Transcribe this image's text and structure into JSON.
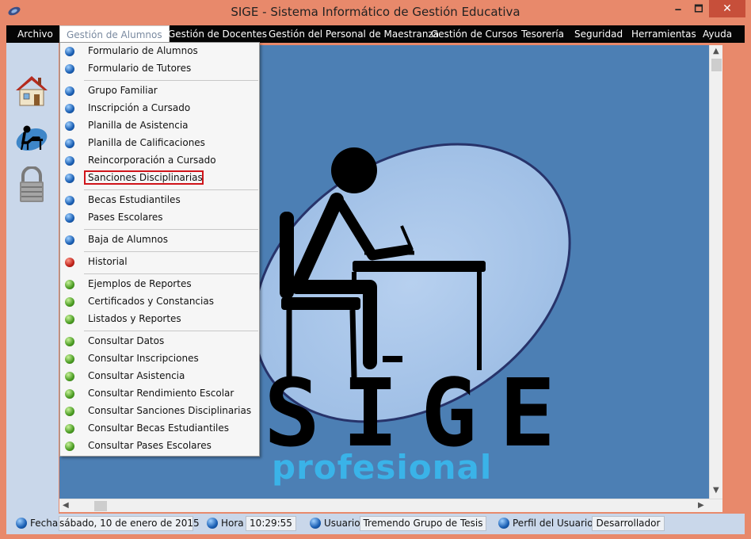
{
  "window": {
    "title": "SIGE - Sistema Informático de Gestión Educativa",
    "minimize": "🗕",
    "maximize": "🗖",
    "close": "✕"
  },
  "menubar": {
    "items": [
      "Archivo",
      "Gestión de Alumnos",
      "Gestión de Docentes",
      "Gestión del Personal de Maestranza",
      "Gestión de Cursos",
      "Tesorería",
      "Seguridad",
      "Herramientas",
      "Ayuda"
    ],
    "active": "Gestión de Alumnos"
  },
  "toolbar": {
    "icons": [
      "home-icon",
      "student-desk-icon",
      "padlock-icon"
    ]
  },
  "dropdown": {
    "items": [
      {
        "label": "Formulario de Alumnos",
        "color": "blue"
      },
      {
        "label": "Formulario de Tutores",
        "color": "blue"
      },
      {
        "label": "Grupo Familiar",
        "color": "blue"
      },
      {
        "label": "Inscripción a Cursado",
        "color": "blue"
      },
      {
        "label": "Planilla de Asistencia",
        "color": "blue"
      },
      {
        "label": "Planilla de Calificaciones",
        "color": "blue"
      },
      {
        "label": "Reincorporación a Cursado",
        "color": "blue"
      },
      {
        "label": "Sanciones Disciplinarias",
        "color": "blue",
        "highlighted": true
      },
      {
        "label": "Becas Estudiantiles",
        "color": "blue"
      },
      {
        "label": "Pases Escolares",
        "color": "blue"
      },
      {
        "label": "Baja de Alumnos",
        "color": "blue"
      },
      {
        "label": "Historial",
        "color": "red"
      },
      {
        "label": "Ejemplos de Reportes",
        "color": "green"
      },
      {
        "label": "Certificados y Constancias",
        "color": "green"
      },
      {
        "label": "Listados y Reportes",
        "color": "green"
      },
      {
        "label": "Consultar Datos",
        "color": "green"
      },
      {
        "label": "Consultar Inscripciones",
        "color": "green"
      },
      {
        "label": "Consultar Asistencia",
        "color": "green"
      },
      {
        "label": "Consultar Rendimiento Escolar",
        "color": "green"
      },
      {
        "label": "Consultar Sanciones Disciplinarias",
        "color": "green"
      },
      {
        "label": "Consultar Becas Estudiantiles",
        "color": "green"
      },
      {
        "label": "Consultar Pases Escolares",
        "color": "green"
      }
    ]
  },
  "logo": {
    "text": "SIGE",
    "subtext": "profesional"
  },
  "statusbar": {
    "fecha_label": "Fecha",
    "fecha_value": "sábado, 10 de enero de 2015",
    "hora_label": "Hora",
    "hora_value": "10:29:55",
    "usuario_label": "Usuario",
    "usuario_value": "Tremendo Grupo de Tesis",
    "perfil_label": "Perfil del Usuario",
    "perfil_value": "Desarrollador"
  },
  "colors": {
    "window_frame": "#e8896b",
    "menubar": "#050505",
    "main_background": "#4c7fb4",
    "ellipse": "#a9c6e8",
    "subtext": "#3ab3e8",
    "highlight": "#d0141a"
  }
}
